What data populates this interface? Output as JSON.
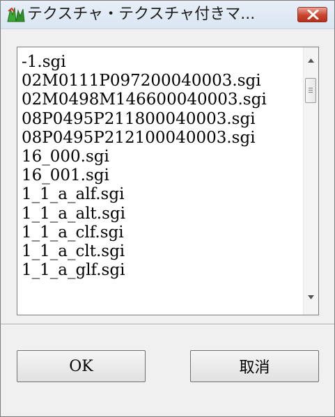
{
  "window": {
    "title": "テクスチャ・テクスチャ付きマ...",
    "icon": "texture-app-icon",
    "close_icon": "close-icon"
  },
  "list": {
    "items": [
      "-1.sgi",
      "02M0111P097200040003.sgi",
      "02M0498M146600040003.sgi",
      "08P0495P211800040003.sgi",
      "08P0495P212100040003.sgi",
      "16_000.sgi",
      "16_001.sgi",
      "1_1_a_alf.sgi",
      "1_1_a_alt.sgi",
      "1_1_a_clf.sgi",
      "1_1_a_clt.sgi",
      "1_1_a_glf.sgi"
    ]
  },
  "buttons": {
    "ok_label": "OK",
    "cancel_label": "取消"
  },
  "colors": {
    "close_red": "#c8442f",
    "window_bg": "#f0f0f0",
    "list_bg": "#ffffff"
  }
}
